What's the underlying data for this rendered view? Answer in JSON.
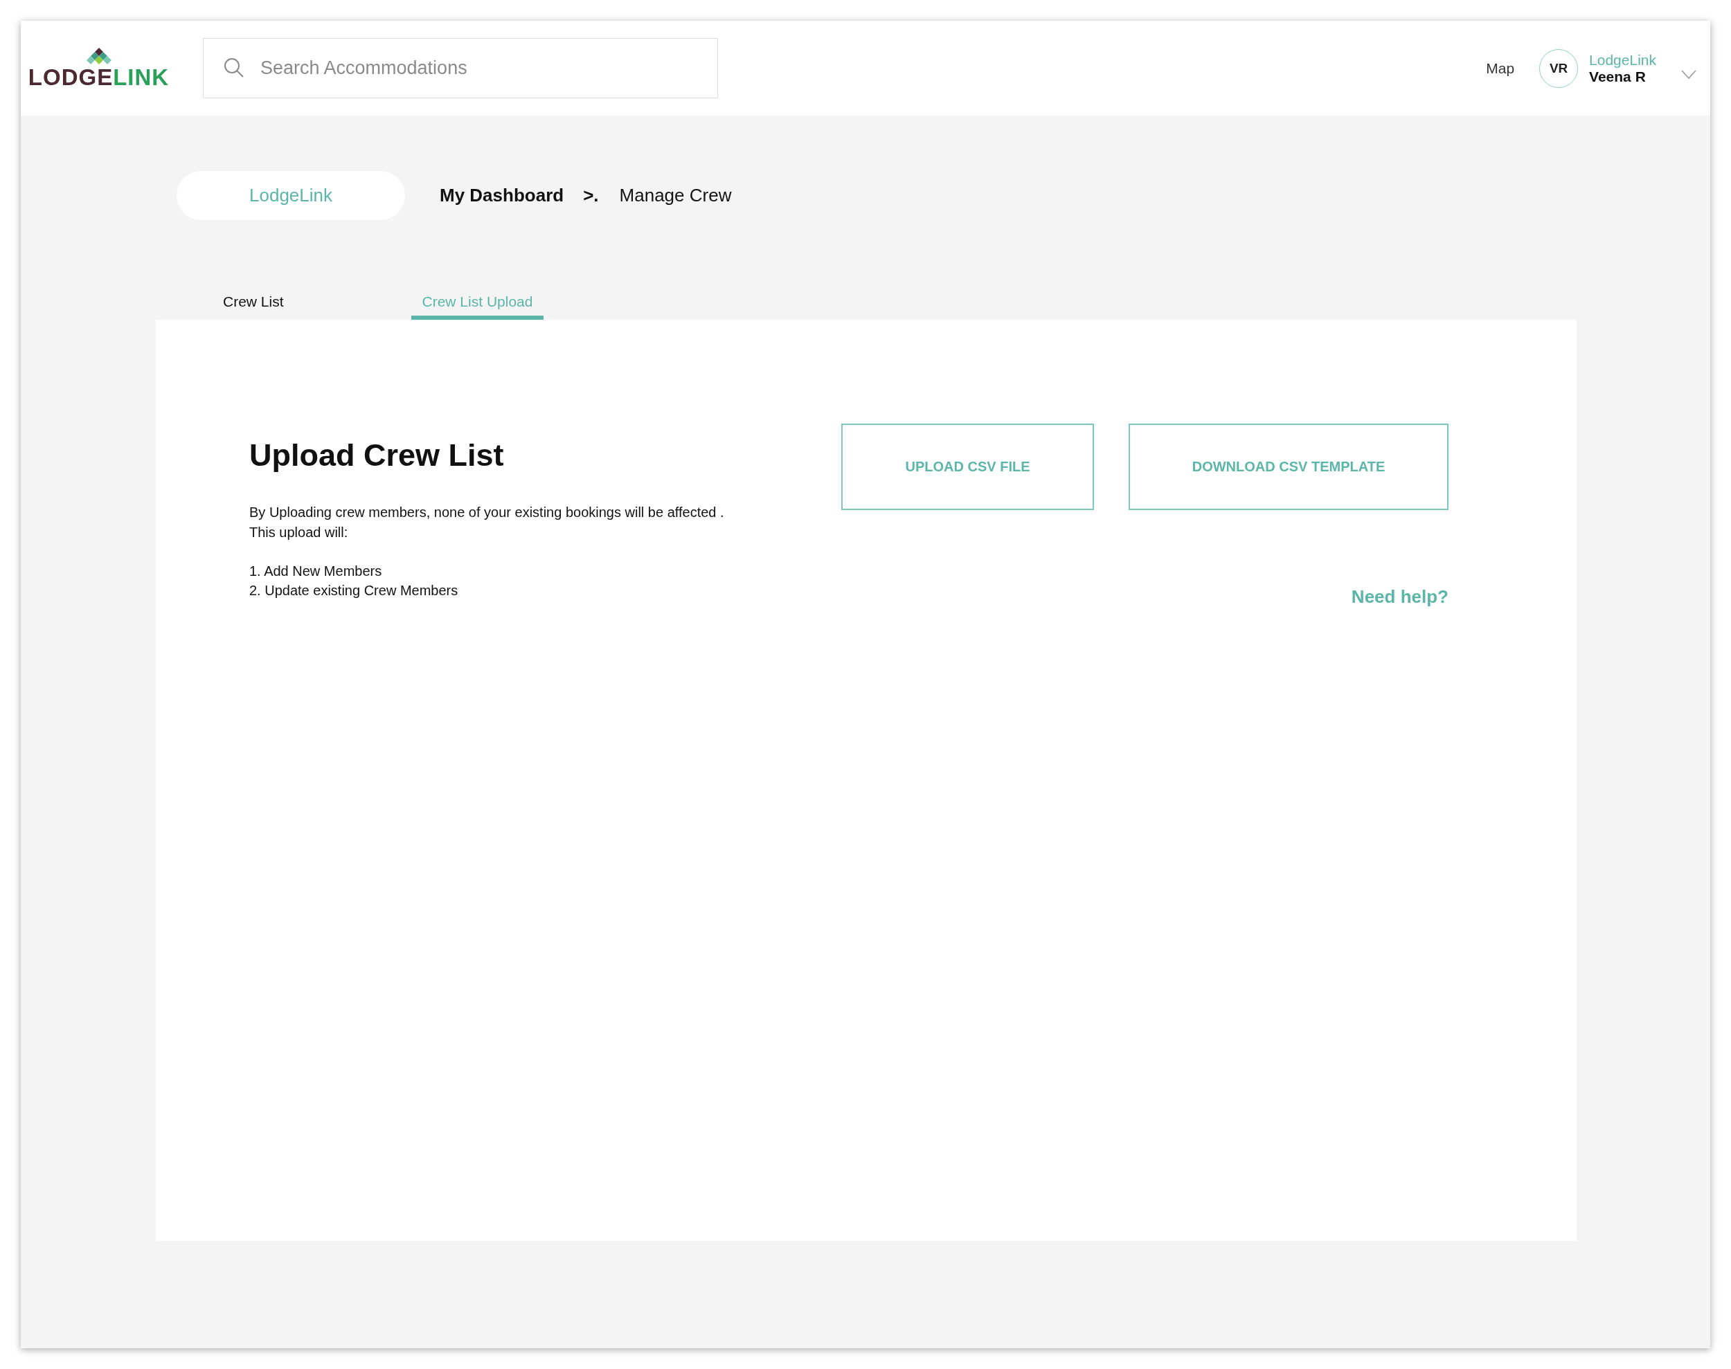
{
  "header": {
    "logo": {
      "dark_part": "LODGE",
      "light_part": "LINK"
    },
    "search": {
      "placeholder": "Search Accommodations"
    },
    "map_link": "Map",
    "user": {
      "initials": "VR",
      "company": "LodgeLink",
      "name": "Veena R"
    }
  },
  "breadcrumb": {
    "home": "LodgeLink",
    "items": [
      {
        "label": "My Dashboard",
        "current": false
      },
      {
        "label": "Manage Crew",
        "current": true
      }
    ],
    "separator": ">."
  },
  "tabs": [
    {
      "label": "Crew List",
      "selected": false
    },
    {
      "label": "Crew List Upload",
      "selected": true
    }
  ],
  "panel": {
    "title": "Upload Crew List",
    "description": [
      "By Uploading crew members, none of your existing bookings will be affected .",
      "This upload will:"
    ],
    "steps": [
      "1. Add New Members",
      "2. Update existing Crew Members"
    ],
    "buttons": [
      "UPLOAD CSV FILE",
      "DOWNLOAD CSV TEMPLATE"
    ],
    "help_link": "Need help?"
  }
}
